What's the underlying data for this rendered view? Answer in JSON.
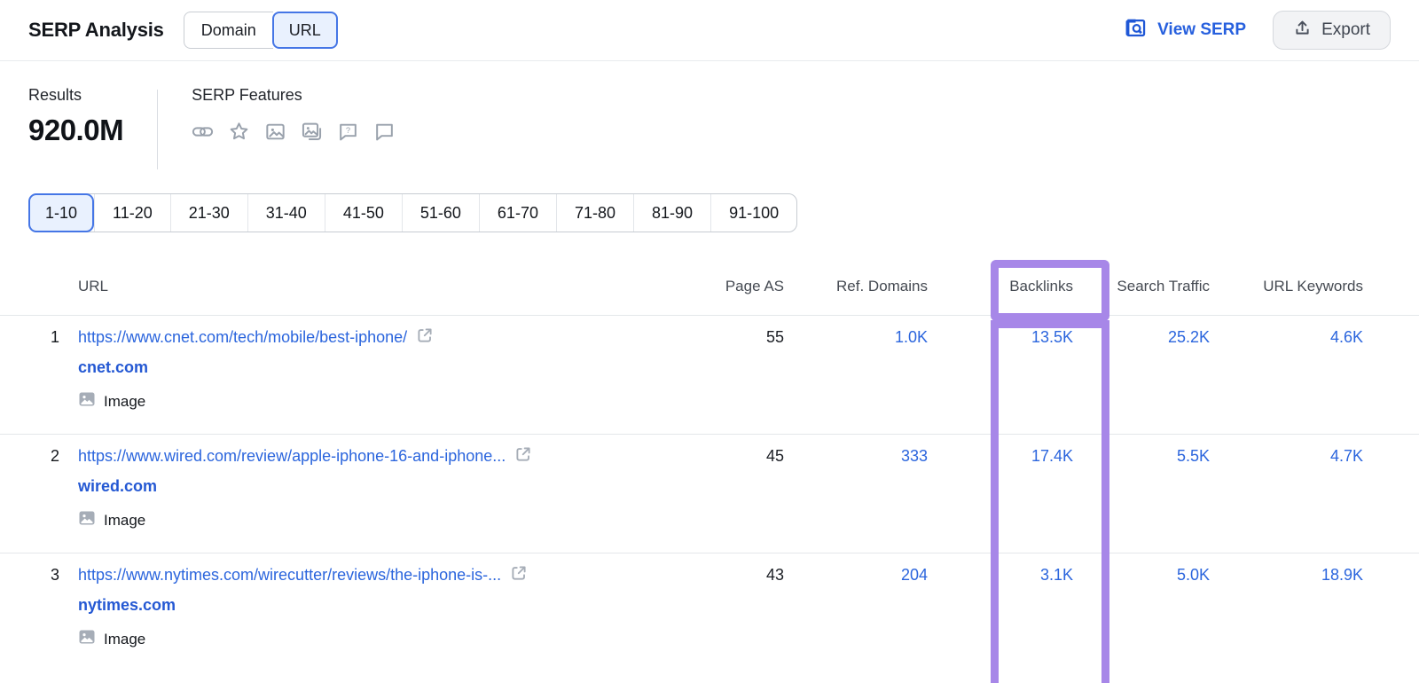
{
  "header": {
    "title": "SERP Analysis",
    "toggle": {
      "options": [
        "Domain",
        "URL"
      ],
      "selected": "URL"
    },
    "view_serp_label": "View SERP",
    "export_label": "Export"
  },
  "summary": {
    "results_label": "Results",
    "results_value": "920.0M",
    "serp_features_label": "SERP Features",
    "feature_icons": [
      "link-icon",
      "star-icon",
      "image-icon",
      "image-pack-icon",
      "faq-bubble-icon",
      "comment-bubble-icon"
    ]
  },
  "pagination": {
    "items": [
      "1-10",
      "11-20",
      "21-30",
      "31-40",
      "41-50",
      "51-60",
      "61-70",
      "71-80",
      "81-90",
      "91-100"
    ],
    "selected": "1-10"
  },
  "table": {
    "columns": [
      "URL",
      "Page AS",
      "Ref. Domains",
      "Backlinks",
      "Search Traffic",
      "URL Keywords"
    ],
    "highlighted_column": "Backlinks",
    "rows": [
      {
        "position": "1",
        "url": "https://www.cnet.com/tech/mobile/best-iphone/",
        "domain": "cnet.com",
        "serp_feature": "Image",
        "page_as": "55",
        "ref_domains": "1.0K",
        "backlinks": "13.5K",
        "search_traffic": "25.2K",
        "url_keywords": "4.6K"
      },
      {
        "position": "2",
        "url": "https://www.wired.com/review/apple-iphone-16-and-iphone...",
        "domain": "wired.com",
        "serp_feature": "Image",
        "page_as": "45",
        "ref_domains": "333",
        "backlinks": "17.4K",
        "search_traffic": "5.5K",
        "url_keywords": "4.7K"
      },
      {
        "position": "3",
        "url": "https://www.nytimes.com/wirecutter/reviews/the-iphone-is-...",
        "domain": "nytimes.com",
        "serp_feature": "Image",
        "page_as": "43",
        "ref_domains": "204",
        "backlinks": "3.1K",
        "search_traffic": "5.0K",
        "url_keywords": "18.9K"
      }
    ]
  },
  "colors": {
    "link_blue": "#2b65dd",
    "accent_blue": "#4576e6",
    "selected_bg": "#e9f1fe",
    "highlight_purple": "#a787e8",
    "icon_gray": "#99a1ac"
  }
}
